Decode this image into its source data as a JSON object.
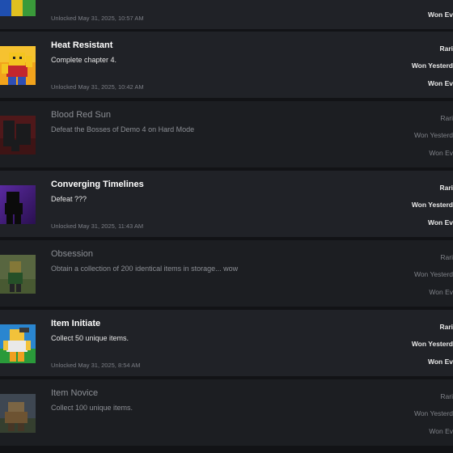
{
  "badges": [
    {
      "title": "",
      "description": "",
      "unlocked": "Unlocked May 31, 2025, 10:57 AM",
      "rarity": "",
      "won_yesterday": "",
      "won_ever": "Won Ev"
    },
    {
      "title": "Heat Resistant",
      "description": "Complete chapter 4.",
      "unlocked": "Unlocked May 31, 2025, 10:42 AM",
      "rarity": "Rari",
      "won_yesterday": "Won Yesterd",
      "won_ever": "Won Ev"
    },
    {
      "title": "Blood Red Sun",
      "description": "Defeat the Bosses of Demo 4 on Hard Mode",
      "unlocked": "",
      "rarity": "Rari",
      "won_yesterday": "Won Yesterd",
      "won_ever": "Won Ev"
    },
    {
      "title": "Converging Timelines",
      "description": "Defeat ???",
      "unlocked": "Unlocked May 31, 2025, 11:43 AM",
      "rarity": "Rari",
      "won_yesterday": "Won Yesterd",
      "won_ever": "Won Ev"
    },
    {
      "title": "Obsession",
      "description": "Obtain a collection of 200 identical items in storage... wow",
      "unlocked": "",
      "rarity": "Rari",
      "won_yesterday": "Won Yesterd",
      "won_ever": "Won Ev"
    },
    {
      "title": "Item Initiate",
      "description": "Collect 50 unique items.",
      "unlocked": "Unlocked May 31, 2025, 8:54 AM",
      "rarity": "Rari",
      "won_yesterday": "Won Yesterd",
      "won_ever": "Won Ev"
    },
    {
      "title": "Item Novice",
      "description": "Collect 100 unique items.",
      "unlocked": "",
      "rarity": "Rari",
      "won_yesterday": "Won Yesterd",
      "won_ever": "Won Ev"
    }
  ],
  "colors": {
    "page_bg": "#121316",
    "row_bg": "#202227",
    "row_locked_bg": "#1c1e22",
    "text_primary": "#ffffff",
    "text_muted": "#8c8f95"
  }
}
